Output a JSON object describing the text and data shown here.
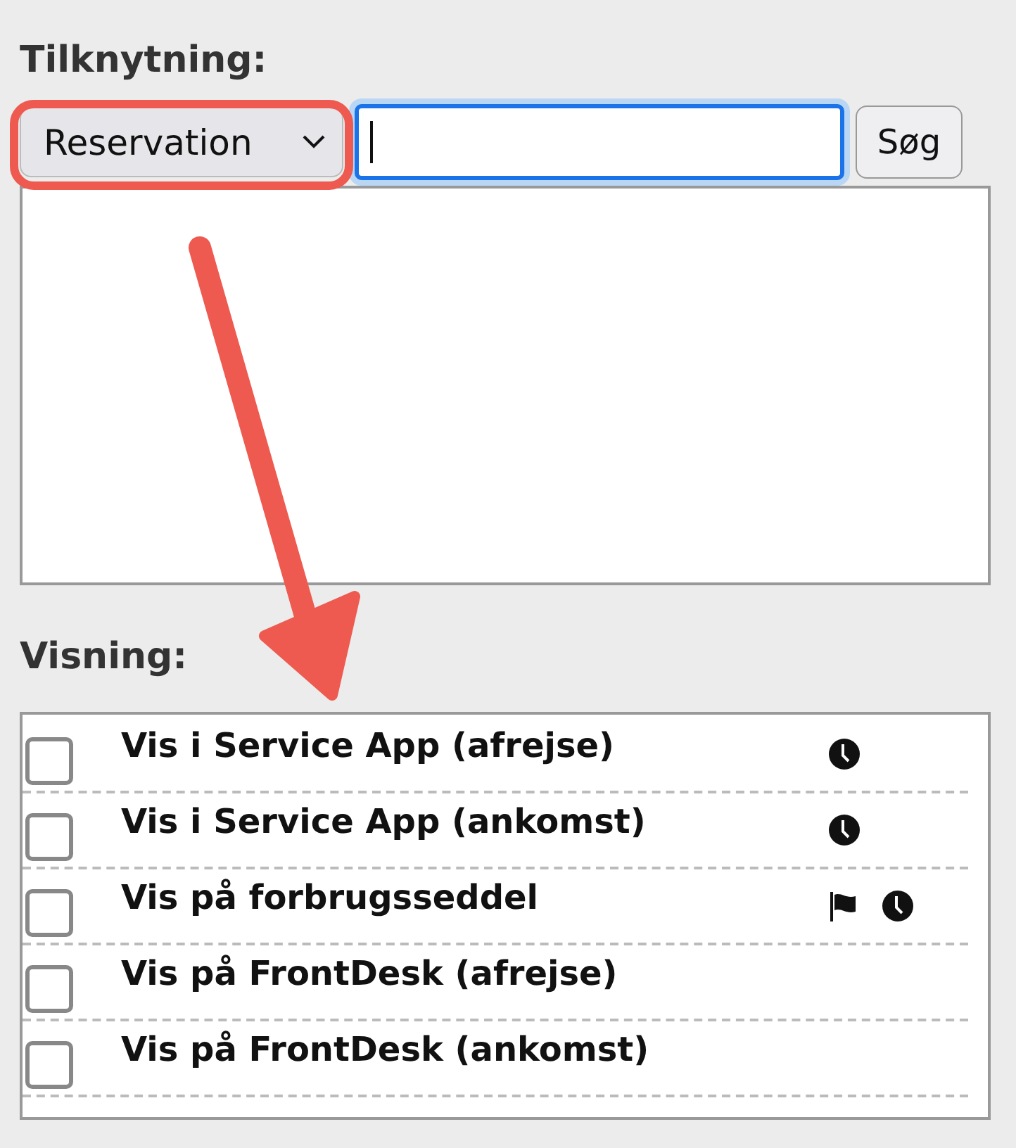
{
  "association": {
    "heading": "Tilknytning:",
    "type_select": {
      "value": "Reservation"
    },
    "search": {
      "focused": true
    },
    "search_button": "Søg"
  },
  "display": {
    "heading": "Visning:",
    "options": [
      {
        "label": "Vis i Service App (afrejse)",
        "checked": false,
        "markers": [
          {
            "kind": "clock"
          }
        ]
      },
      {
        "label": "Vis i Service App (ankomst)",
        "checked": false,
        "markers": [
          {
            "kind": "clock"
          }
        ]
      },
      {
        "label": "Vis på forbrugsseddel",
        "checked": false,
        "markers": [
          {
            "kind": "flag"
          },
          {
            "kind": "clock"
          }
        ]
      },
      {
        "label": "Vis på FrontDesk (afrejse)",
        "checked": false
      },
      {
        "label": "Vis på FrontDesk (ankomst)",
        "checked": false
      }
    ]
  },
  "annotations": {
    "highlight_outline": true,
    "arrow": true
  }
}
